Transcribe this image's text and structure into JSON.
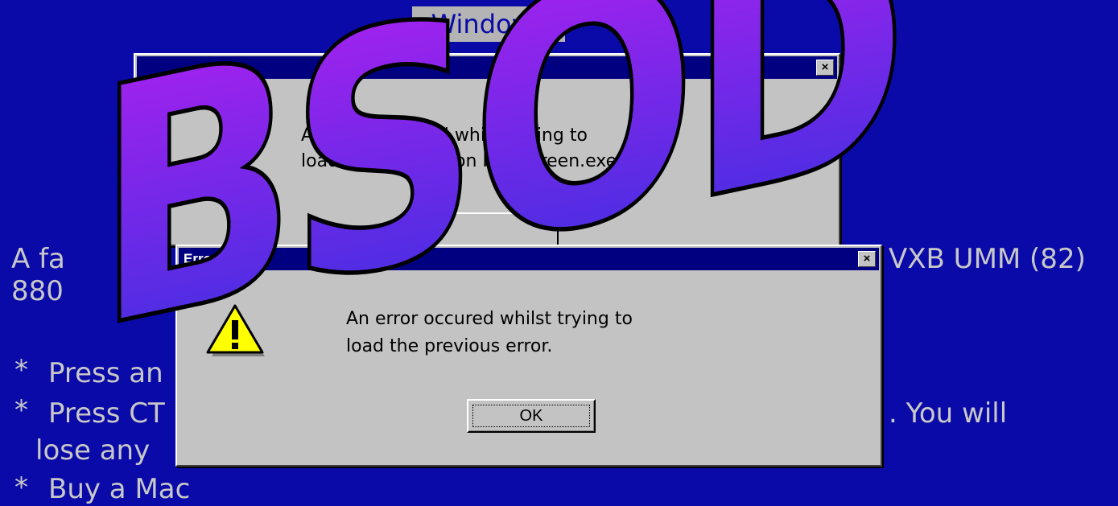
{
  "header_tag": "Windows",
  "bsod": {
    "line1_prefix": "A fa",
    "line1_suffix": "VXB UMM (82)",
    "line2_prefix": "880",
    "bullets": [
      {
        "star": "*",
        "text": "Press an"
      },
      {
        "star": "*",
        "text": "Press CT",
        "suffix": ". You will"
      },
      {
        "star": "",
        "text": "lose any"
      },
      {
        "star": "*",
        "text": "Buy a Mac"
      }
    ]
  },
  "back_dialog": {
    "message_line1": "An error occured whilst trying to",
    "message_line2": "load the application bluescreen.exe\"",
    "close_glyph": "×"
  },
  "front_dialog": {
    "title": "Error Error",
    "message_line1": "An error occured whilst trying to",
    "message_line2": "load the previous error.",
    "ok_label": "OK",
    "close_glyph": "×"
  },
  "logo": {
    "text": "BSOD",
    "gradient_top": "#b020f0",
    "gradient_bottom": "#3a30e0"
  }
}
